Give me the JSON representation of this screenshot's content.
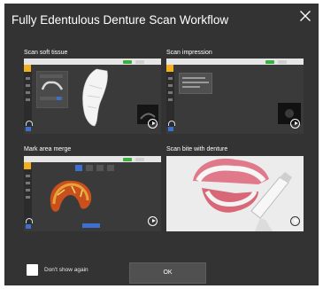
{
  "dialog": {
    "title": "Fully Edentulous Denture Scan Workflow",
    "close_icon": "close-icon"
  },
  "panels": [
    {
      "label": "Scan soft tissue"
    },
    {
      "label": "Scan impression"
    },
    {
      "label": "Mark area merge"
    },
    {
      "label": "Scan bite with denture"
    }
  ],
  "footer": {
    "checkbox_label": "Don't show again",
    "checkbox_checked": false,
    "ok_label": "OK"
  },
  "colors": {
    "dialog_bg": "#333333",
    "accent_yellow": "#f2b01e",
    "accent_blue": "#3b6fd0",
    "accent_green": "#3cb043"
  }
}
